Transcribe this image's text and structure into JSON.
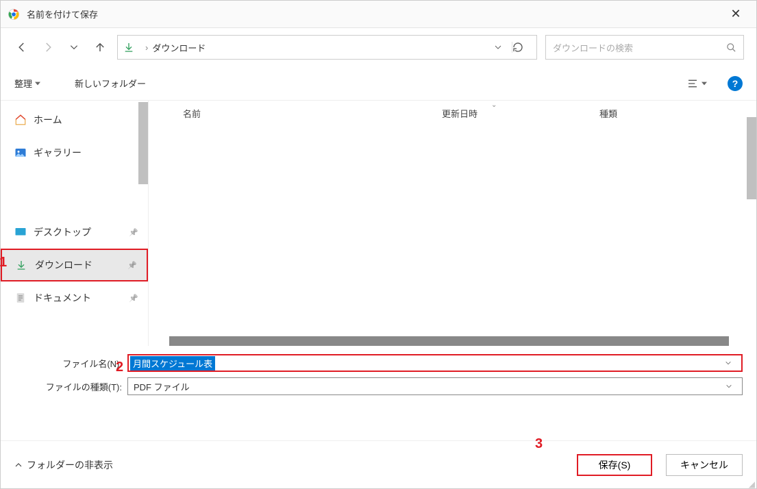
{
  "titlebar": {
    "title": "名前を付けて保存",
    "close": "✕"
  },
  "nav": {
    "path_segment": "ダウンロード"
  },
  "search": {
    "placeholder": "ダウンロードの検索"
  },
  "toolbar": {
    "organize": "整理",
    "newfolder": "新しいフォルダー",
    "help": "?"
  },
  "sidebar": {
    "group1": [
      {
        "label": "ホーム"
      },
      {
        "label": "ギャラリー"
      }
    ],
    "group2": [
      {
        "label": "デスクトップ"
      },
      {
        "label": "ダウンロード"
      },
      {
        "label": "ドキュメント"
      }
    ]
  },
  "columns": {
    "name": "名前",
    "date": "更新日時",
    "type": "種類"
  },
  "fields": {
    "filename_label": "ファイル名(N):",
    "filename_value": "月間スケジュール表",
    "filetype_label": "ファイルの種類(T):",
    "filetype_value": "PDF ファイル"
  },
  "footer": {
    "toggle": "フォルダーの非表示",
    "save": "保存(S)",
    "cancel": "キャンセル"
  },
  "annotations": {
    "a1": "1",
    "a2": "2",
    "a3": "3"
  }
}
